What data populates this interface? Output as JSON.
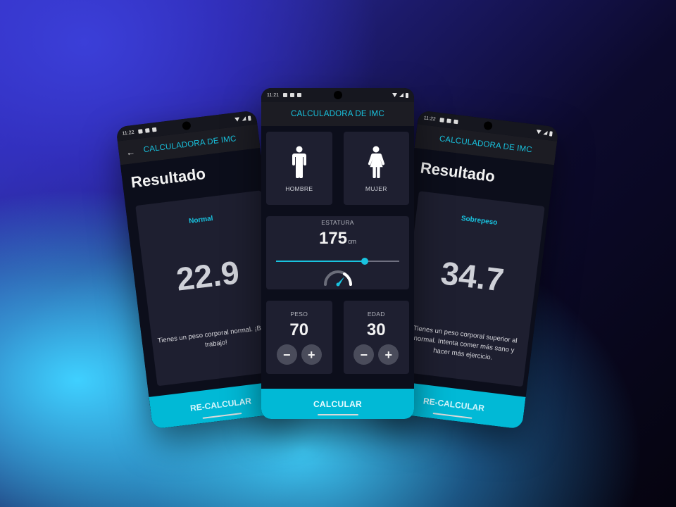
{
  "left_phone": {
    "status_time": "11:22",
    "appbar_title": "CALCULADORA DE IMC",
    "result_title": "Resultado",
    "status": "Normal",
    "value": "22.9",
    "description": "Tienes un peso corporal normal. ¡Buen trabajo!",
    "button": "RE-CALCULAR"
  },
  "center_phone": {
    "status_time": "11:21",
    "appbar_title": "CALCULADORA DE IMC",
    "gender_male": "HOMBRE",
    "gender_female": "MUJER",
    "height_label": "ESTATURA",
    "height_value": "175",
    "height_unit": "cm",
    "height_slider_fraction": 0.72,
    "weight_label": "PESO",
    "weight_value": "70",
    "age_label": "EDAD",
    "age_value": "30",
    "minus_symbol": "−",
    "plus_symbol": "+",
    "button": "CALCULAR"
  },
  "right_phone": {
    "status_time": "11:22",
    "appbar_title": "CALCULADORA DE IMC",
    "result_title": "Resultado",
    "status": "Sobrepeso",
    "value": "34.7",
    "description": "Tienes un peso corporal superior al normal. Intenta comer más sano y hacer más ejercicio.",
    "button": "RE-CALCULAR"
  },
  "colors": {
    "accent": "#19c3df",
    "button": "#01b9d6",
    "card": "#1e1f30",
    "background": "#0c0e1b"
  }
}
